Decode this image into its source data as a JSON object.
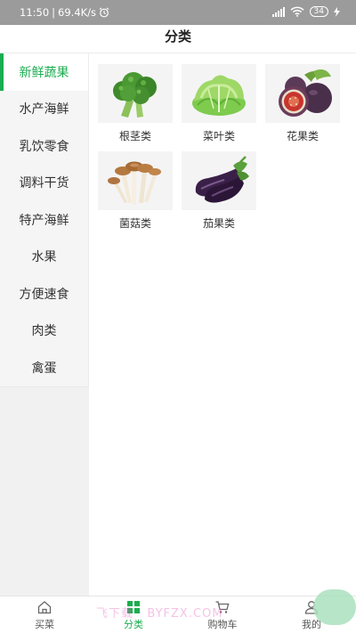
{
  "status_bar": {
    "time": "11:50",
    "speed": "69.4K/s",
    "battery": "34"
  },
  "header": {
    "title": "分类"
  },
  "sidebar": {
    "items": [
      {
        "label": "新鲜蔬果",
        "active": true
      },
      {
        "label": "水产海鲜",
        "active": false
      },
      {
        "label": "乳饮零食",
        "active": false
      },
      {
        "label": "调料干货",
        "active": false
      },
      {
        "label": "特产海鲜",
        "active": false
      },
      {
        "label": "水果",
        "active": false
      },
      {
        "label": "方便速食",
        "active": false
      },
      {
        "label": "肉类",
        "active": false
      },
      {
        "label": "禽蛋",
        "active": false
      }
    ]
  },
  "subcategories": [
    {
      "label": "根茎类",
      "icon": "broccoli-icon"
    },
    {
      "label": "菜叶类",
      "icon": "lettuce-icon"
    },
    {
      "label": "花果类",
      "icon": "fig-icon"
    },
    {
      "label": "菌菇类",
      "icon": "mushroom-icon"
    },
    {
      "label": "茄果类",
      "icon": "eggplant-icon"
    }
  ],
  "tabbar": {
    "items": [
      {
        "label": "买菜",
        "icon": "home-icon",
        "active": false
      },
      {
        "label": "分类",
        "icon": "category-icon",
        "active": true
      },
      {
        "label": "购物车",
        "icon": "cart-icon",
        "active": false
      },
      {
        "label": "我的",
        "icon": "user-icon",
        "active": false
      }
    ]
  },
  "watermark": "飞下载 · BYFZX.COM",
  "colors": {
    "accent": "#1aad4f",
    "status_bar": "#9b9b9b",
    "sidebar_bg": "#f5f5f5"
  }
}
